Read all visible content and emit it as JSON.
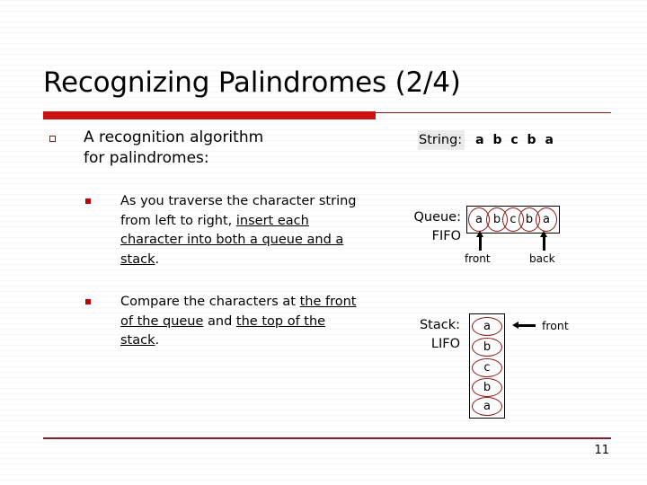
{
  "slide": {
    "title": "Recognizing Palindromes (2/4)",
    "page_number": "11",
    "accent_color": "#cc1111",
    "rule_color": "#8c1919",
    "footer_rule_color": "#7d2430"
  },
  "content": {
    "bullet1": {
      "icon": "hollow-square-bullet",
      "line1": "A recognition algorithm",
      "line2": "for palindromes:"
    },
    "sub_bullets": [
      {
        "icon": "filled-square-bullet",
        "plain_prefix": "As you traverse the character string from left to right, ",
        "underlined": "insert each character into both a queue and a stack",
        "plain_suffix": "."
      },
      {
        "icon": "filled-square-bullet",
        "plain_prefix": "Compare the characters at ",
        "underlined": "the front of the queue",
        "plain_middle": " and ",
        "underlined2": "the top of the stack",
        "plain_suffix": "."
      }
    ]
  },
  "diagram": {
    "string": {
      "label": "String:",
      "value": "a b c b a"
    },
    "queue": {
      "label_line1": "Queue:",
      "label_line2": "FIFO",
      "cells": [
        "a",
        "b",
        "c",
        "b",
        "a"
      ],
      "pointer_front": "front",
      "pointer_back": "back",
      "cell_outline_color": "#8b1a1a"
    },
    "stack": {
      "label_line1": "Stack:",
      "label_line2": "LIFO",
      "cells": [
        "a",
        "b",
        "c",
        "b",
        "a"
      ],
      "pointer_label": "front",
      "cell_outline_color": "#8b1a1a"
    }
  }
}
